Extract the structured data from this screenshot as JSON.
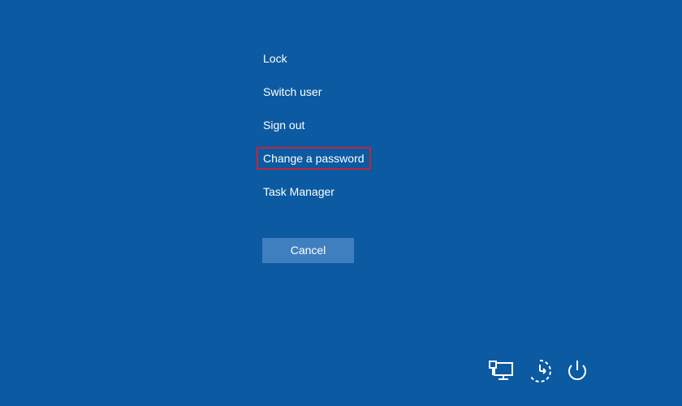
{
  "menu": {
    "items": [
      {
        "label": "Lock"
      },
      {
        "label": "Switch user"
      },
      {
        "label": "Sign out"
      },
      {
        "label": "Change a password"
      },
      {
        "label": "Task Manager"
      }
    ],
    "highlighted_index": 3,
    "highlight_color": "#c1263b"
  },
  "cancel_button": {
    "label": "Cancel"
  },
  "tray": {
    "icons": [
      "network-icon",
      "accessibility-icon",
      "power-icon"
    ]
  },
  "colors": {
    "background": "#0b5aa2",
    "button": "#3f7fbf",
    "text": "#ffffff"
  }
}
